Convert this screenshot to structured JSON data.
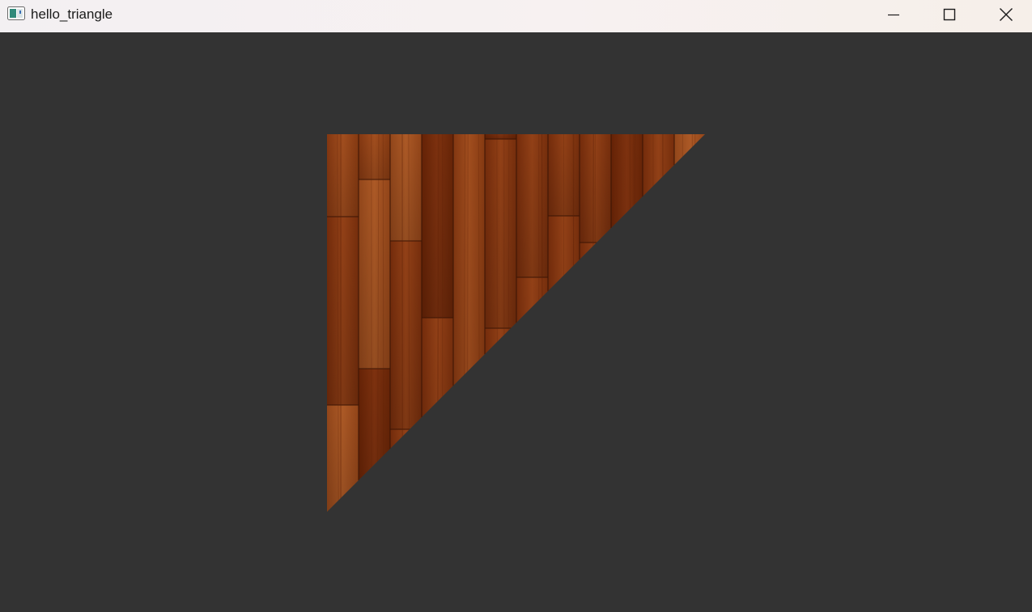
{
  "window": {
    "title": "hello_triangle",
    "app_icon": "application-window-icon",
    "controls": {
      "minimize_icon": "minimize-icon",
      "maximize_icon": "maximize-icon",
      "close_icon": "close-icon"
    }
  },
  "viewport": {
    "clear_color": "#333333",
    "primitive": "triangle",
    "texture": "wooden-floor-planks",
    "texture_colors": {
      "light": "#a04a18",
      "mid": "#8a3a10",
      "dark": "#6a2608",
      "seam": "#3a1404"
    }
  }
}
